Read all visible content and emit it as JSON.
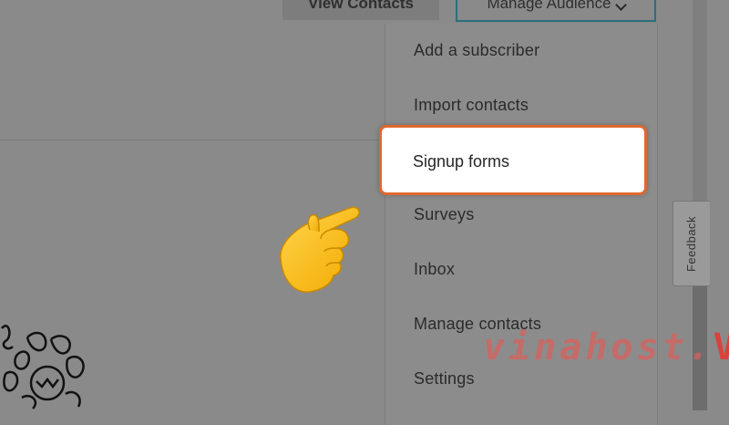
{
  "header": {
    "view_contacts_label": "View Contacts",
    "manage_audience_label": "Manage Audience"
  },
  "menu": {
    "items": [
      {
        "label": "Add a subscriber"
      },
      {
        "label": "Import contacts"
      },
      {
        "label": "Signup forms"
      },
      {
        "label": "Surveys"
      },
      {
        "label": "Inbox"
      },
      {
        "label": "Manage contacts"
      },
      {
        "label": "Settings"
      }
    ],
    "highlighted_index": 2
  },
  "feedback_tab": {
    "label": "Feedback"
  },
  "watermark": {
    "text": "vinahost.",
    "mark": "V"
  },
  "icons": {
    "dropdown": "chevron-down-icon",
    "pointer": "pointing-hand-icon"
  },
  "colors": {
    "highlight_border": "#e0682e",
    "manage_button_border": "#2c6f7d",
    "overlay_gray": "#8a8a8a",
    "watermark_red": "#d9423a"
  }
}
